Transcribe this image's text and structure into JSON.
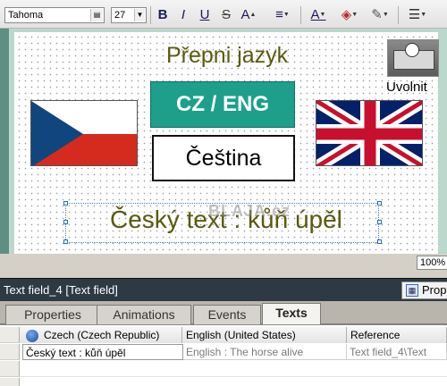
{
  "toolbar": {
    "font_name": "Tahoma",
    "font_size": "27",
    "bold": "B",
    "italic": "I",
    "underline": "U",
    "strike": "S",
    "grow_font": "A",
    "align": "≡",
    "font_color": "A",
    "fill_color": "◈",
    "line_color": "✎",
    "line_style": "☰"
  },
  "screen": {
    "title": "Přepni jazyk",
    "toggle_button": "CZ / ENG",
    "language_box": "Čeština",
    "release_label": "Uvolnit",
    "text_field": "Český text : kůň úpěl",
    "watermark": "BLAJA.cz",
    "zoom": "100%"
  },
  "panel": {
    "title": "Text field_4 [Text field]",
    "prop_button": "Prop",
    "tabs": [
      "Properties",
      "Animations",
      "Events",
      "Texts"
    ],
    "active_tab": "Texts",
    "columns": [
      "Czech (Czech Republic)",
      "English (United States)",
      "Reference"
    ],
    "rows": [
      {
        "czech": "Český text : kůň úpěl",
        "english": "English : The horse alive",
        "reference": "Text field_4\\Text"
      }
    ]
  },
  "colors": {
    "toggle_bg": "#1e9f8c",
    "title_text": "#5a5a10",
    "panel_header": "#2d3a44",
    "canvas_border": "#5e8f82"
  }
}
